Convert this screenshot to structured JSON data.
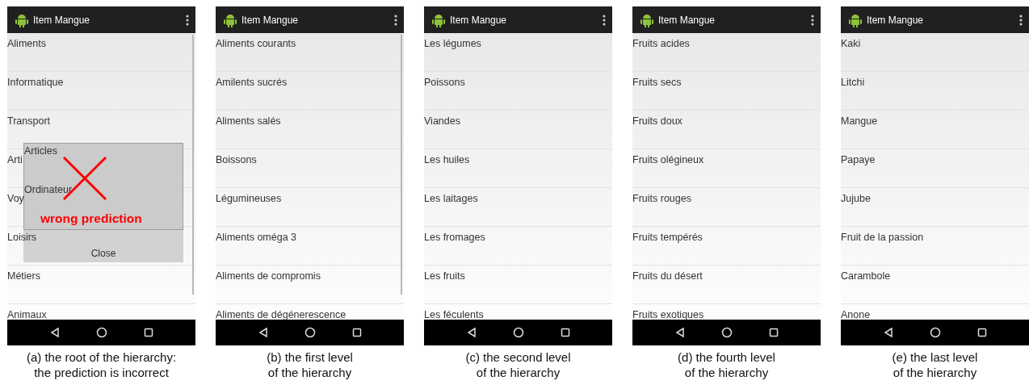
{
  "panels": [
    {
      "title": "Item Mangue",
      "items": [
        "Aliments",
        "Informatique",
        "Transport",
        "Arti",
        "Voy",
        "Loisirs",
        "Métiers",
        "Animaux"
      ],
      "scrollbar": true,
      "dialog": {
        "items": [
          "Articles",
          "Ordinateur"
        ],
        "button": "Close",
        "annotation": "wrong prediction"
      },
      "caption": [
        "(a)  the root of the hierarchy:",
        "the prediction is incorrect"
      ]
    },
    {
      "title": "Item Mangue",
      "items": [
        "Aliments courants",
        "Amilents sucrés",
        "Aliments salés",
        "Boissons",
        "Légumineuses",
        "Aliments oméga 3",
        "Aliments de compromis",
        "Aliments de dégénerescence"
      ],
      "scrollbar": true,
      "caption": [
        "(b) the first level",
        "of the hierarchy"
      ]
    },
    {
      "title": "Item Mangue",
      "items": [
        "Les légumes",
        "Poissons",
        "Viandes",
        "Les huiles",
        "Les laitages",
        "Les fromages",
        "Les fruits",
        "Les féculents"
      ],
      "scrollbar": false,
      "caption": [
        "(c) the second level",
        "of the hierarchy"
      ]
    },
    {
      "title": "Item Mangue",
      "items": [
        "Fruits acides",
        "Fruits secs",
        "Fruits doux",
        "Fruits olégineux",
        "Fruits rouges",
        "Fruits tempérés",
        "Fruits du désert",
        "Fruits exotiques"
      ],
      "scrollbar": false,
      "caption": [
        "(d) the fourth level",
        "of the hierarchy"
      ]
    },
    {
      "title": "Item Mangue",
      "items": [
        "Kaki",
        "Litchi",
        "Mangue",
        "Papaye",
        "Jujube",
        "Fruit de la passion",
        "Carambole",
        "Anone"
      ],
      "scrollbar": false,
      "caption": [
        "(e) the last level",
        "of the hierarchy"
      ]
    }
  ]
}
